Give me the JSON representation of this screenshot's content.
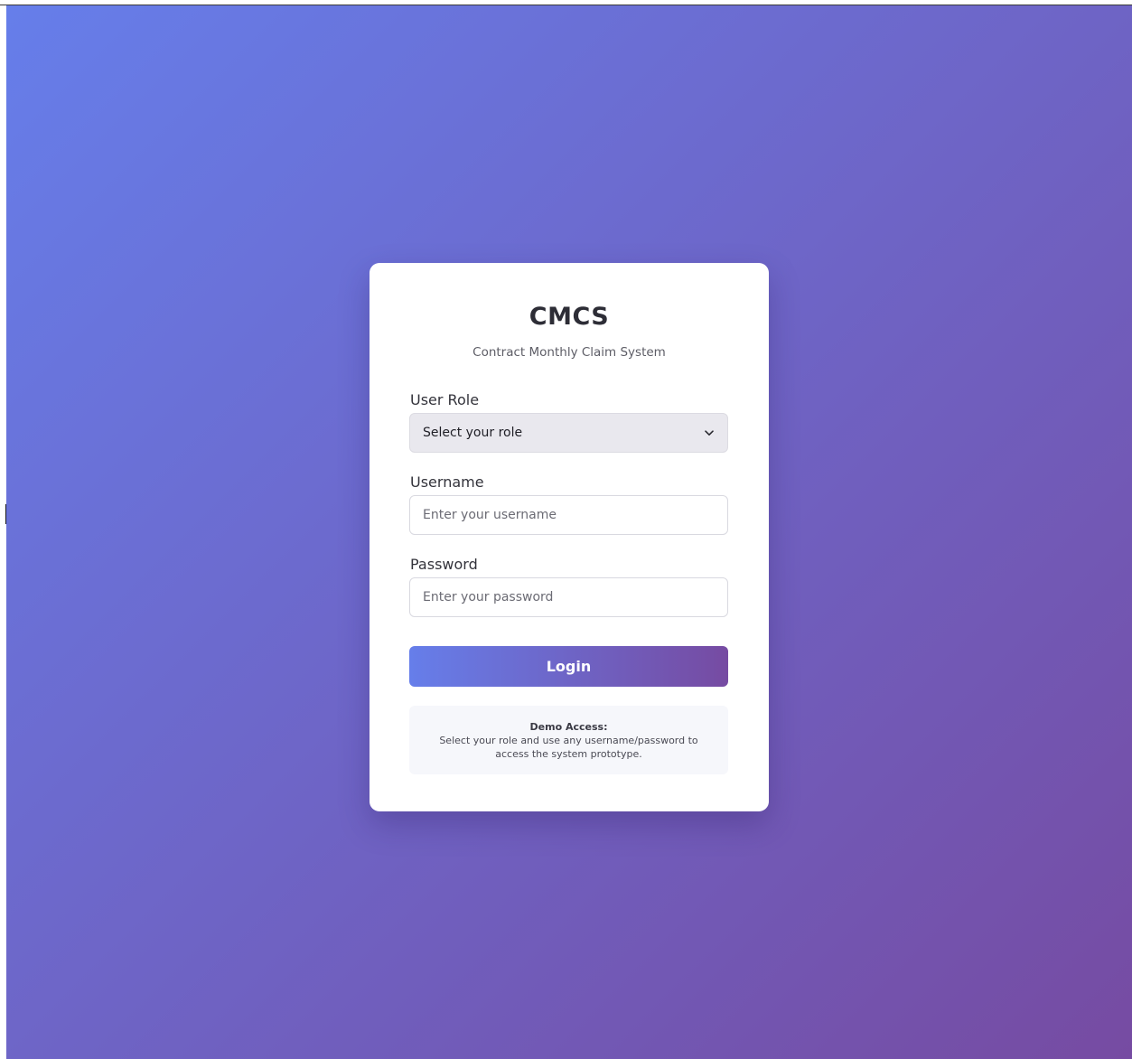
{
  "app": {
    "title": "CMCS",
    "subtitle": "Contract Monthly Claim System"
  },
  "form": {
    "role": {
      "label": "User Role",
      "selected": "Select your role"
    },
    "username": {
      "label": "Username",
      "placeholder": "Enter your username",
      "value": ""
    },
    "password": {
      "label": "Password",
      "placeholder": "Enter your password",
      "value": ""
    },
    "submit_label": "Login"
  },
  "demo": {
    "title": "Demo Access:",
    "text": "Select your role and use any username/password to access the system prototype."
  },
  "colors": {
    "gradient_start": "#667eea",
    "gradient_end": "#764ba2",
    "card_background": "#ffffff",
    "select_background": "#e9e8ee",
    "demo_background": "#f6f7fb"
  },
  "icons": {
    "select_chevron": "chevron-down-icon"
  }
}
